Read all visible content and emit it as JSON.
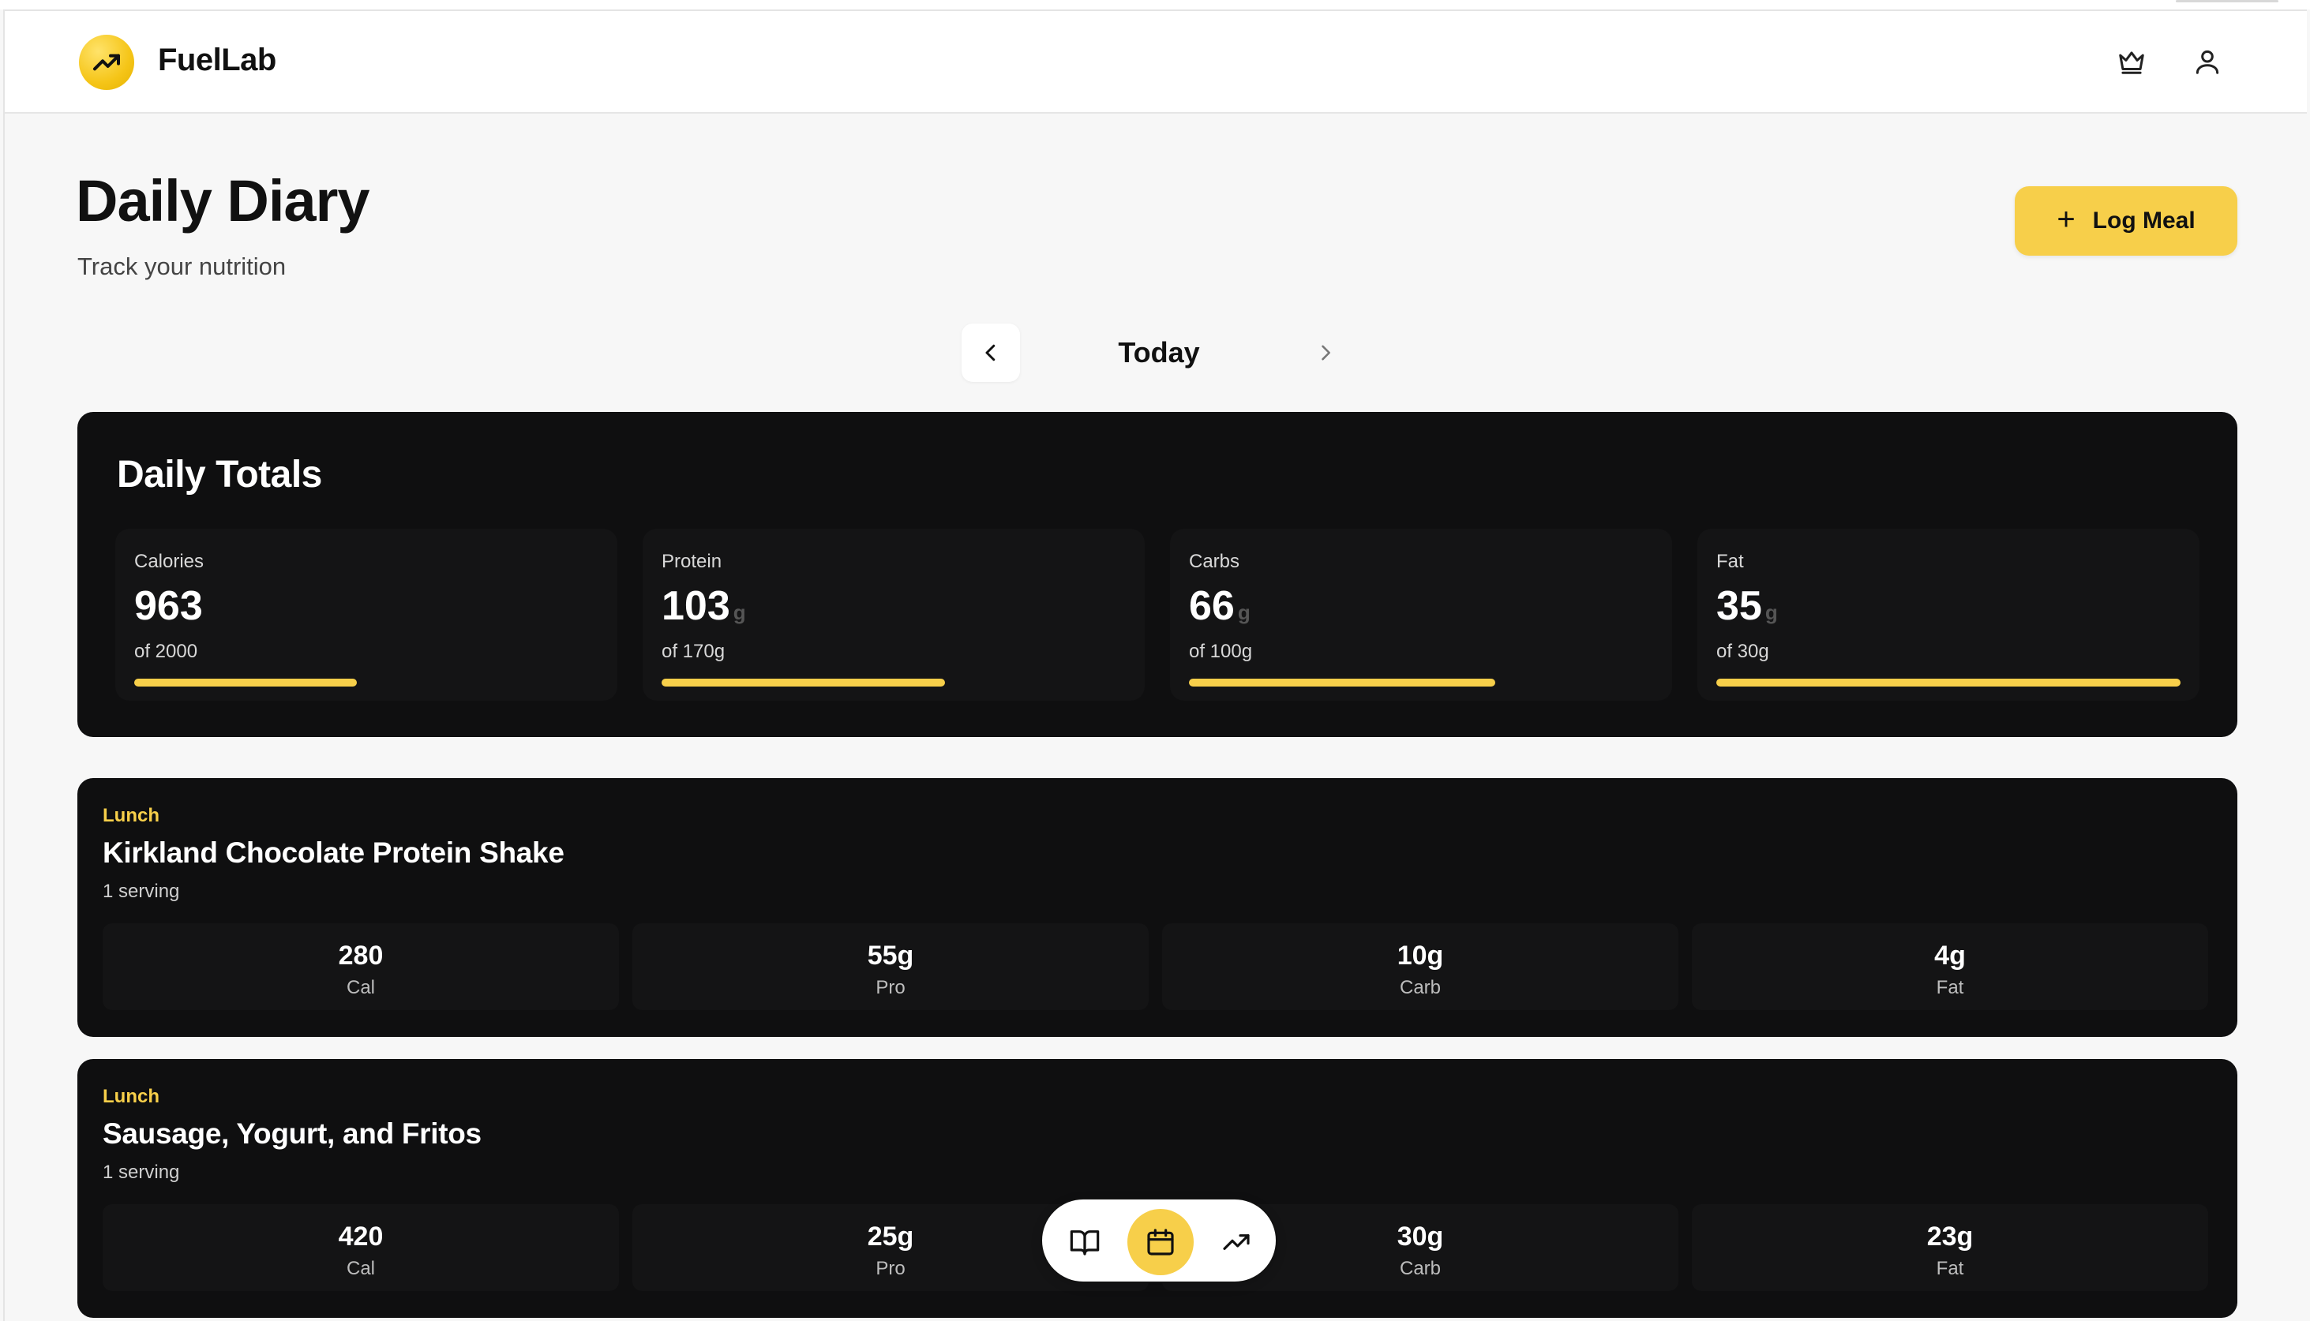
{
  "app": {
    "name": "FuelLab"
  },
  "header": {
    "icons": [
      "crown-icon",
      "user-icon",
      "trending-up-icon"
    ]
  },
  "page": {
    "title": "Daily Diary",
    "subtitle": "Track your nutrition",
    "log_button_label": "Log Meal",
    "log_button_icon": "plus-icon"
  },
  "date_nav": {
    "label": "Today"
  },
  "totals": {
    "title": "Daily Totals",
    "stats": [
      {
        "label": "Calories",
        "value": "963",
        "unit": "",
        "goal": "of 2000",
        "progress": 0.48
      },
      {
        "label": "Protein",
        "value": "103",
        "unit": "g",
        "goal": "of 170g",
        "progress": 0.61
      },
      {
        "label": "Carbs",
        "value": "66",
        "unit": "g",
        "goal": "of 100g",
        "progress": 0.66
      },
      {
        "label": "Fat",
        "value": "35",
        "unit": "g",
        "goal": "of 30g",
        "progress": 1.0
      }
    ]
  },
  "meals": [
    {
      "type": "Lunch",
      "name": "Kirkland Chocolate Protein Shake",
      "serving": "1 serving",
      "macros": [
        {
          "value": "280",
          "label": "Cal"
        },
        {
          "value": "55g",
          "label": "Pro"
        },
        {
          "value": "10g",
          "label": "Carb"
        },
        {
          "value": "4g",
          "label": "Fat"
        }
      ]
    },
    {
      "type": "Lunch",
      "name": "Sausage, Yogurt, and Fritos",
      "serving": "1 serving",
      "macros": [
        {
          "value": "420",
          "label": "Cal"
        },
        {
          "value": "25g",
          "label": "Pro"
        },
        {
          "value": "30g",
          "label": "Carb"
        },
        {
          "value": "23g",
          "label": "Fat"
        }
      ]
    }
  ],
  "bottom_nav": {
    "items": [
      "book-open-icon",
      "calendar-icon",
      "trending-up-icon"
    ],
    "active": "calendar-icon"
  },
  "colors": {
    "accent": "#f7cf4a",
    "card": "#0f0f10",
    "background": "#f7f7f7"
  }
}
